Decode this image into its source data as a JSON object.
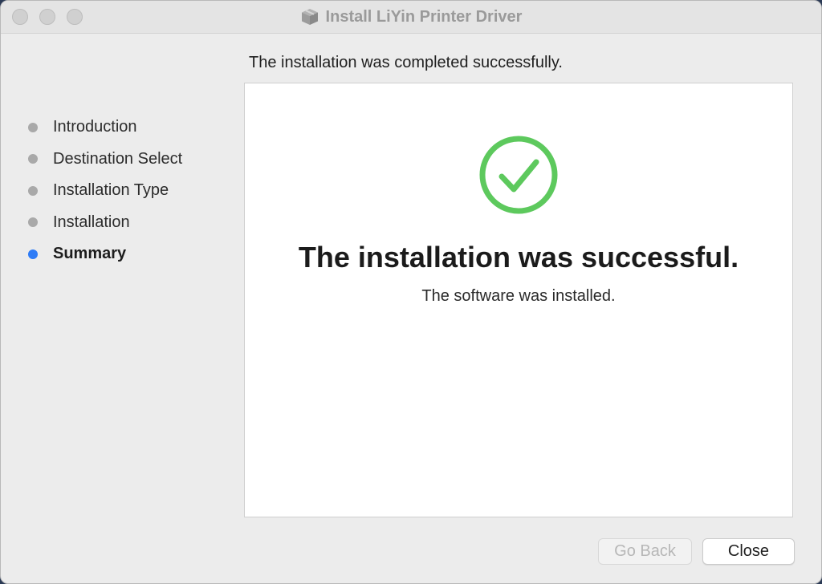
{
  "window": {
    "title": "Install LiYin Printer Driver",
    "title_icon": "package-icon"
  },
  "header": {
    "text": "The installation was completed successfully."
  },
  "sidebar": {
    "items": [
      {
        "label": "Introduction",
        "active": false
      },
      {
        "label": "Destination Select",
        "active": false
      },
      {
        "label": "Installation Type",
        "active": false
      },
      {
        "label": "Installation",
        "active": false
      },
      {
        "label": "Summary",
        "active": true
      }
    ]
  },
  "content": {
    "icon": "checkmark-circle-icon",
    "title": "The installation was successful.",
    "subtitle": "The software was installed."
  },
  "buttons": {
    "back_label": "Go Back",
    "back_enabled": false,
    "close_label": "Close"
  },
  "colors": {
    "accent": "#2f7cf6",
    "success": "#5dc95d",
    "inactive_dot": "#a9a9a9"
  }
}
